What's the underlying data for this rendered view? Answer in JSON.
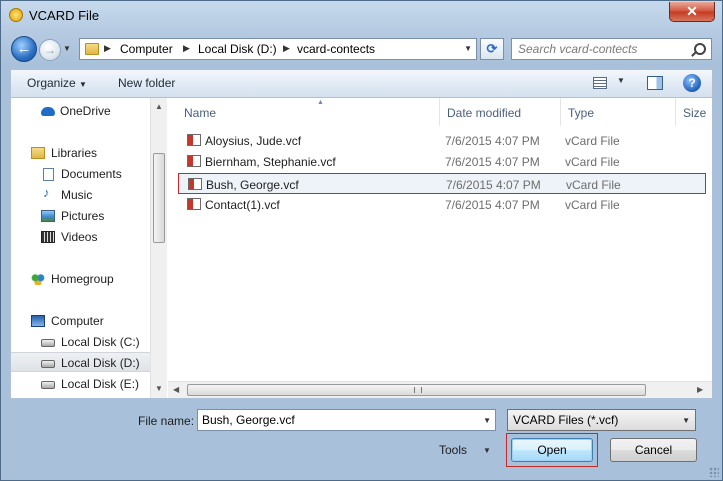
{
  "window": {
    "title": "VCARD File",
    "close_label": "✕"
  },
  "address": {
    "crumbs": [
      "Computer",
      "Local Disk (D:)",
      "vcard-contects"
    ],
    "search_placeholder": "Search vcard-contects"
  },
  "toolbar": {
    "organize_label": "Organize",
    "new_folder_label": "New folder",
    "help_label": "?"
  },
  "nav": {
    "items": [
      {
        "label": "OneDrive"
      },
      {
        "label": "Libraries"
      },
      {
        "label": "Documents"
      },
      {
        "label": "Music"
      },
      {
        "label": "Pictures"
      },
      {
        "label": "Videos"
      },
      {
        "label": "Homegroup"
      },
      {
        "label": "Computer"
      },
      {
        "label": "Local Disk (C:)"
      },
      {
        "label": "Local Disk (D:)"
      },
      {
        "label": "Local Disk (E:)"
      }
    ],
    "selected": "Local Disk (D:)"
  },
  "columns": [
    "Name",
    "Date modified",
    "Type",
    "Size"
  ],
  "files": [
    {
      "name": "Aloysius, Jude.vcf",
      "date": "7/6/2015 4:07 PM",
      "type": "vCard File"
    },
    {
      "name": "Biernham, Stephanie.vcf",
      "date": "7/6/2015 4:07 PM",
      "type": "vCard File"
    },
    {
      "name": "Bush, George.vcf",
      "date": "7/6/2015 4:07 PM",
      "type": "vCard File",
      "selected": true
    },
    {
      "name": "Contact(1).vcf",
      "date": "7/6/2015 4:07 PM",
      "type": "vCard File"
    }
  ],
  "bottom": {
    "file_name_label": "File name:",
    "file_name_value": "Bush, George.vcf",
    "filter_value": "VCARD Files (*.vcf)",
    "tools_label": "Tools",
    "open_label": "Open",
    "cancel_label": "Cancel"
  },
  "colors": {
    "selection_outline": "#c42a2a",
    "accent": "#3c7fb1"
  }
}
